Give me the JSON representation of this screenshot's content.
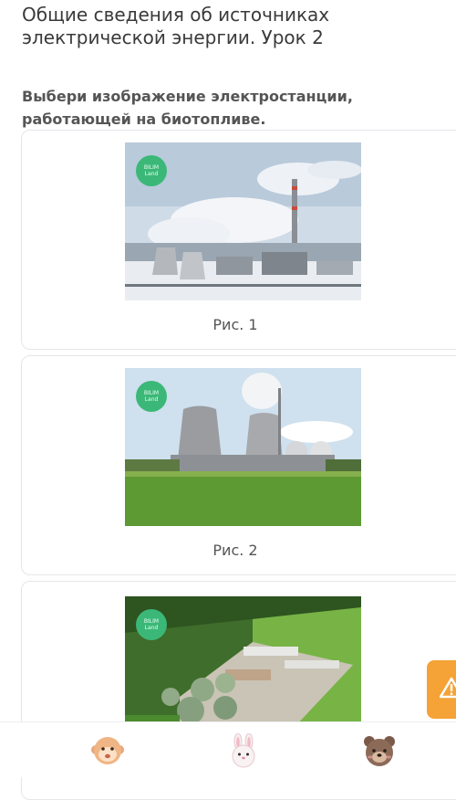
{
  "lesson": {
    "title": "Общие сведения об источниках электрической энергии. Урок 2"
  },
  "question": {
    "text": "Выбери изображение электростанции, работающей на биотопливе."
  },
  "options": [
    {
      "caption": "Рис. 1",
      "logo_line1": "BILIM",
      "logo_line2": "Land"
    },
    {
      "caption": "Рис. 2",
      "logo_line1": "BILIM",
      "logo_line2": "Land"
    },
    {
      "logo_line1": "BILIM",
      "logo_line2": "Land"
    }
  ],
  "report_button": {
    "icon": "warning-icon",
    "color": "#f5a236"
  },
  "bottom_bar": {
    "avatars": [
      "monkey-avatar-icon",
      "bunny-avatar-icon",
      "bear-avatar-icon"
    ]
  },
  "colors": {
    "logo_green": "#3bb878",
    "card_border": "#e4e6ea",
    "accent_orange": "#f5a236"
  }
}
